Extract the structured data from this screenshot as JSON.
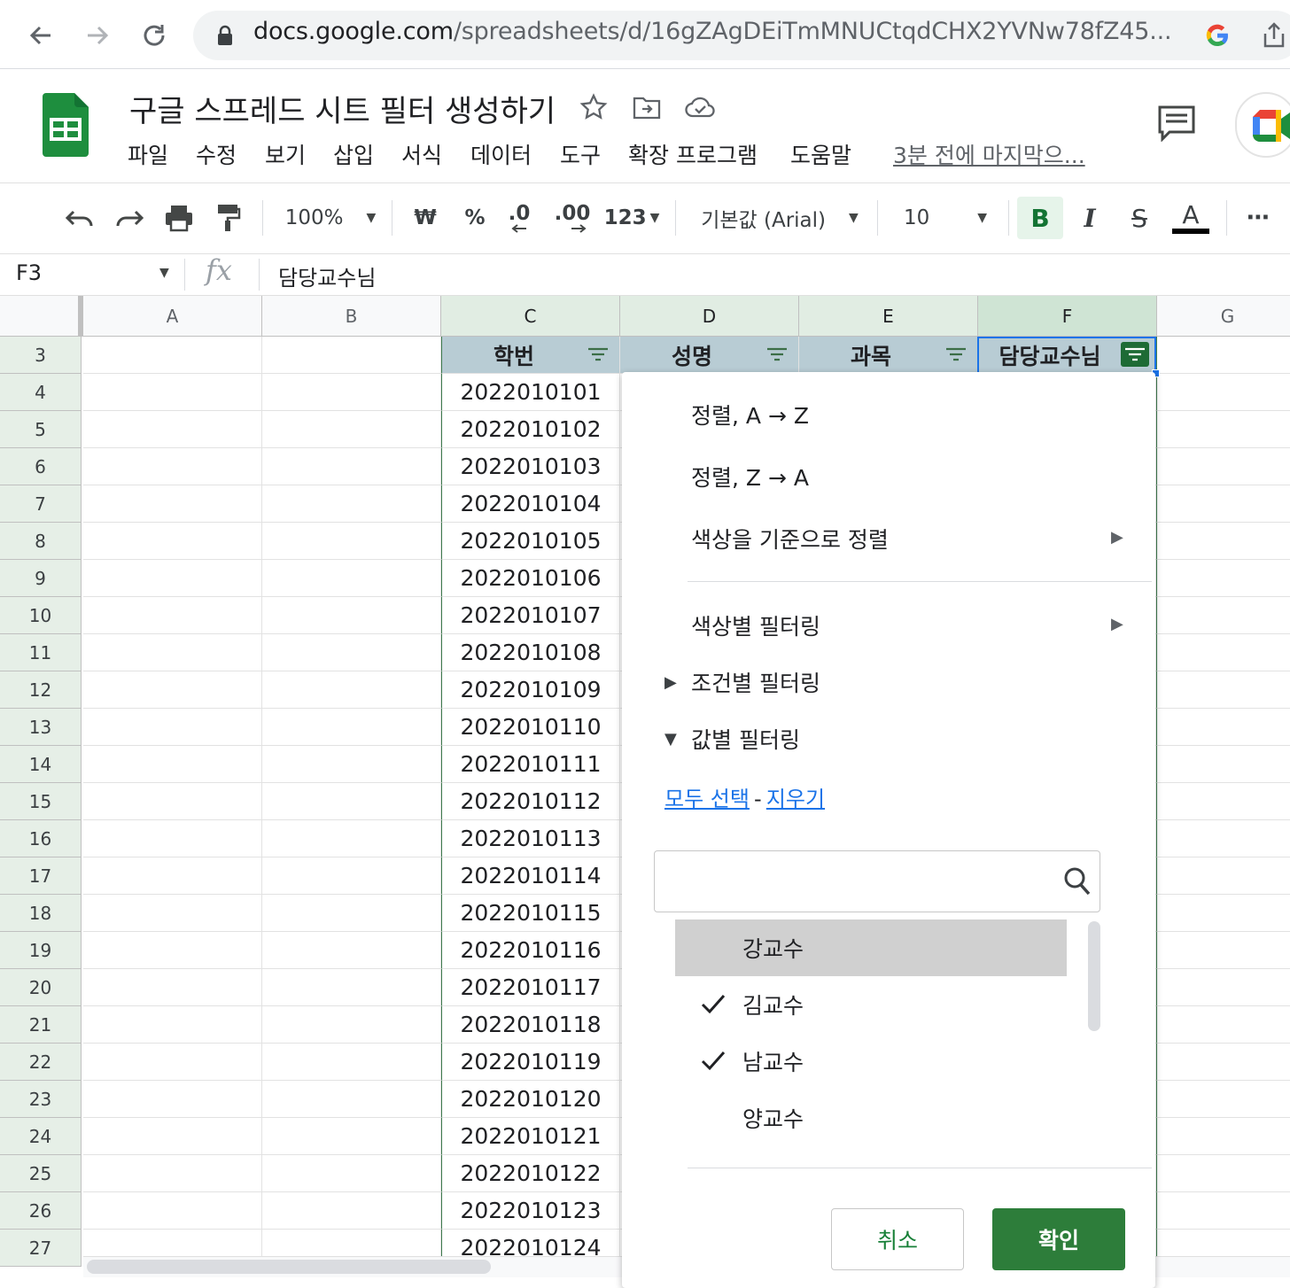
{
  "browser": {
    "url_host": "docs.google.com",
    "url_path": "/spreadsheets/d/16gZAgDEiTmMNUCtqdCHX2YVNw78fZ45..."
  },
  "doc": {
    "title": "구글 스프레드 시트 필터 생성하기",
    "menus": [
      "파일",
      "수정",
      "보기",
      "삽입",
      "서식",
      "데이터",
      "도구",
      "확장 프로그램",
      "도움말"
    ],
    "last_edit": "3분 전에 마지막으..."
  },
  "toolbar": {
    "zoom": "100%",
    "currency": "₩",
    "percent": "%",
    "decimal_decrease": ".0",
    "decimal_increase": ".00",
    "number_format": "123",
    "font": "기본값 (Arial)",
    "font_size": "10",
    "bold": "B",
    "italic": "I",
    "strike": "S",
    "text_color": "A",
    "more": "⋯"
  },
  "formula_bar": {
    "cell_ref": "F3",
    "fx": "fx",
    "content": "담당교수님"
  },
  "grid": {
    "columns": [
      "A",
      "B",
      "C",
      "D",
      "E",
      "F",
      "G"
    ],
    "rows": [
      "3",
      "4",
      "5",
      "6",
      "7",
      "8",
      "9",
      "10",
      "11",
      "12",
      "13",
      "14",
      "15",
      "16",
      "17",
      "18",
      "19",
      "20",
      "21",
      "22",
      "23",
      "24",
      "25",
      "26",
      "27"
    ],
    "headers": [
      "학번",
      "성명",
      "과목",
      "담당교수님"
    ],
    "student_ids": [
      "2022010101",
      "2022010102",
      "2022010103",
      "2022010104",
      "2022010105",
      "2022010106",
      "2022010107",
      "2022010108",
      "2022010109",
      "2022010110",
      "2022010111",
      "2022010112",
      "2022010113",
      "2022010114",
      "2022010115",
      "2022010116",
      "2022010117",
      "2022010118",
      "2022010119",
      "2022010120",
      "2022010121",
      "2022010122",
      "2022010123",
      "2022010124"
    ]
  },
  "filter_panel": {
    "sort_az": "정렬, A → Z",
    "sort_za": "정렬, Z → A",
    "sort_color": "색상을 기준으로 정렬",
    "filter_color": "색상별 필터링",
    "filter_condition": "조건별 필터링",
    "filter_value": "값별 필터링",
    "select_all": "모두 선택",
    "dash": "-",
    "clear": "지우기",
    "search_value": "",
    "values": [
      {
        "label": "강교수",
        "checked": false,
        "hover": true
      },
      {
        "label": "김교수",
        "checked": true,
        "hover": false
      },
      {
        "label": "남교수",
        "checked": true,
        "hover": false
      },
      {
        "label": "양교수",
        "checked": false,
        "hover": false
      }
    ],
    "cancel": "취소",
    "ok": "확인"
  },
  "colors": {
    "sheets_green": "#188038",
    "ok_button": "#2d7d3a",
    "header_fill": "#b8ccd4",
    "link": "#1a73e8"
  }
}
